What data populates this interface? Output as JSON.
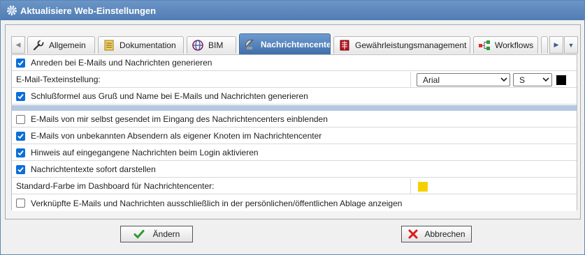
{
  "window": {
    "title": "Aktualisiere Web-Einstellungen"
  },
  "tabs": [
    {
      "label": "Allgemein",
      "icon": "wrench-icon"
    },
    {
      "label": "Dokumentation",
      "icon": "document-stack-icon"
    },
    {
      "label": "BIM",
      "icon": "bim-globe-icon"
    },
    {
      "label": "Nachrichtencenter",
      "icon": "satellite-dish-icon",
      "active": true
    },
    {
      "label": "Gewährleistungsmanagement",
      "icon": "ledger-icon"
    },
    {
      "label": "Workflows",
      "icon": "workflow-icon"
    }
  ],
  "settings": {
    "anreden": {
      "label": "Anreden bei E-Mails und Nachrichten generieren",
      "checked": true
    },
    "texteinstellung": {
      "label": "E-Mail-Texteinstellung:",
      "font": "Arial",
      "size": "S",
      "color": "#000000"
    },
    "schlussformel": {
      "label": "Schlußformel aus Gruß und Name bei E-Mails und Nachrichten generieren",
      "checked": true
    },
    "eigene_mails": {
      "label": "E-Mails von mir selbst gesendet im Eingang des Nachrichtencenters einblenden",
      "checked": false
    },
    "unbekannte": {
      "label": "E-Mails von unbekannten Absendern als eigener Knoten im Nachrichtencenter",
      "checked": true
    },
    "hinweis": {
      "label": "Hinweis auf eingegangene Nachrichten beim Login aktivieren",
      "checked": true
    },
    "sofort": {
      "label": "Nachrichtentexte sofort darstellen",
      "checked": true
    },
    "standardfarbe": {
      "label": "Standard-Farbe im Dashboard für Nachrichtencenter:",
      "color": "#f5d000"
    },
    "verknuepfte": {
      "label": "Verknüpfte E-Mails und Nachrichten ausschließlich in der persönlichen/öffentlichen Ablage anzeigen",
      "checked": false
    }
  },
  "buttons": {
    "ok": "Ändern",
    "cancel": "Abbrechen"
  }
}
